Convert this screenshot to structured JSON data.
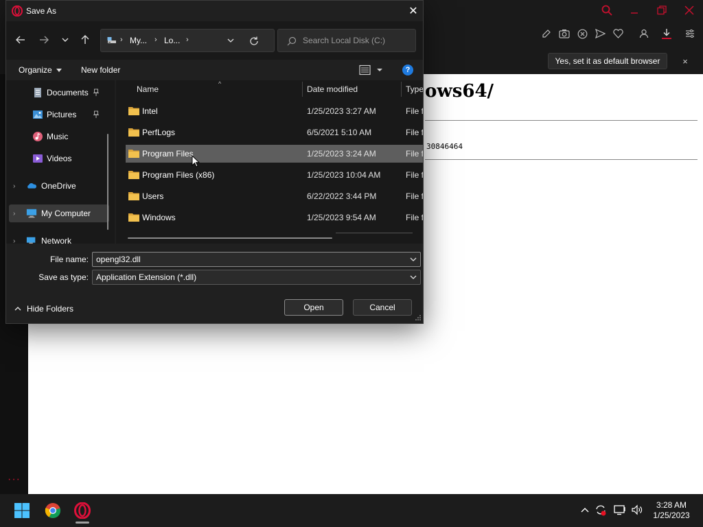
{
  "browser": {
    "infobar_button": "Yes, set it as default browser",
    "infobar_close": "×",
    "page_heading": "ows64/",
    "page_number": "30846464",
    "more_dots": "···"
  },
  "dialog": {
    "title": "Save As",
    "close_glyph": "✕",
    "address_crumbs": [
      "My...",
      "Lo..."
    ],
    "address_chevron": "›",
    "search_placeholder": "Search Local Disk (C:)",
    "organize_label": "Organize",
    "new_folder_label": "New folder",
    "help_glyph": "?",
    "nav_items": [
      {
        "label": "Documents",
        "pinned": true
      },
      {
        "label": "Pictures",
        "pinned": true
      },
      {
        "label": "Music",
        "pinned": false
      },
      {
        "label": "Videos",
        "pinned": false
      },
      {
        "label": "OneDrive",
        "pinned": false
      },
      {
        "label": "My Computer",
        "pinned": false
      },
      {
        "label": "Network",
        "pinned": false
      }
    ],
    "nav_chevron": "›",
    "columns": {
      "name": "Name",
      "date": "Date modified",
      "type": "Type"
    },
    "sort_glyph": "^",
    "files": [
      {
        "name": "Intel",
        "date": "1/25/2023 3:27 AM",
        "type": "File fo"
      },
      {
        "name": "PerfLogs",
        "date": "6/5/2021 5:10 AM",
        "type": "File fo"
      },
      {
        "name": "Program Files",
        "date": "1/25/2023 3:24 AM",
        "type": "File fo"
      },
      {
        "name": "Program Files (x86)",
        "date": "1/25/2023 10:04 AM",
        "type": "File fo"
      },
      {
        "name": "Users",
        "date": "6/22/2022 3:44 PM",
        "type": "File fo"
      },
      {
        "name": "Windows",
        "date": "1/25/2023 9:54 AM",
        "type": "File fo"
      }
    ],
    "selected_file_index": 2,
    "file_name_label": "File name:",
    "file_name_value": "opengl32.dll",
    "save_type_label": "Save as type:",
    "save_type_value": "Application Extension (*.dll)",
    "hide_folders_label": "Hide Folders",
    "open_label": "Open",
    "cancel_label": "Cancel"
  },
  "taskbar": {
    "time": "3:28 AM",
    "date": "1/25/2023"
  },
  "colors": {
    "opera_red": "#c8102e",
    "dialog_bg": "#202020",
    "pane_bg": "#191919",
    "selection": "#5e5e5e",
    "folder_yellow": "#f2c14e",
    "help_blue": "#1f7be0"
  },
  "icons": [
    "opera-logo-icon",
    "search-icon",
    "minimize-icon",
    "restore-icon",
    "close-icon",
    "easy-setup-icon",
    "snapshot-icon",
    "tracker-blocker-icon",
    "send-icon",
    "heart-icon",
    "profile-icon",
    "download-icon",
    "settings-icon",
    "back-icon",
    "forward-icon",
    "history-down-icon",
    "up-icon",
    "drive-icon",
    "refresh-icon",
    "view-list-icon",
    "help-icon",
    "documents-icon",
    "pictures-icon",
    "music-icon",
    "videos-icon",
    "onedrive-icon",
    "computer-icon",
    "network-icon",
    "folder-icon",
    "pin-icon",
    "windows-start-icon",
    "chrome-icon",
    "chevron-up-icon",
    "sync-icon",
    "display-icon",
    "volume-icon"
  ]
}
